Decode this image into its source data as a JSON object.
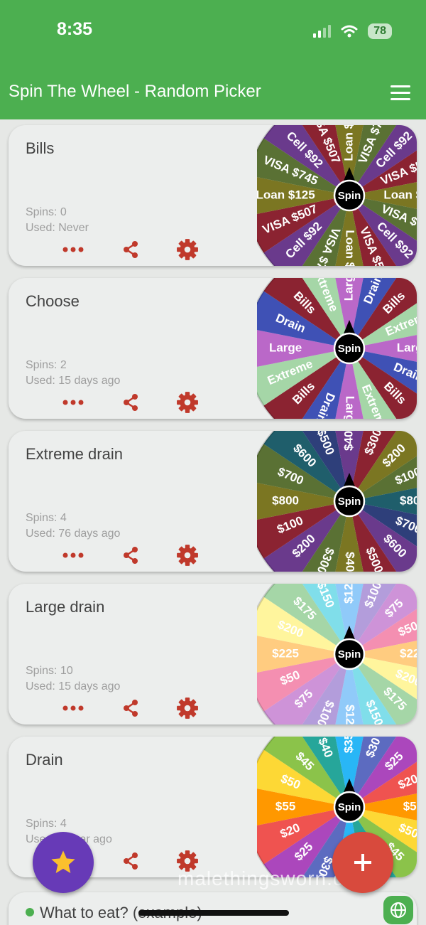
{
  "status_bar": {
    "time": "8:35",
    "battery": "78"
  },
  "header": {
    "title": "Spin The Wheel - Random Picker"
  },
  "wheels": [
    {
      "name": "Bills",
      "spins": "Spins: 0",
      "used": "Used: Never",
      "segments": [
        "Cell $92",
        "VISA $507",
        "Loan $125",
        "VISA $745",
        "Cell $92",
        "VISA $507",
        "Loan $125",
        "VISA $745",
        "Cell $92",
        "VISA $507",
        "Loan $125",
        "VISA $745",
        "Cell $92",
        "VISA $507",
        "Loan $125",
        "VISA $745"
      ],
      "colors": [
        "#6a3a8c",
        "#8b2331",
        "#7b7622",
        "#5a7134"
      ]
    },
    {
      "name": "Choose",
      "spins": "Spins: 2",
      "used": "Used: 15 days ago",
      "segments": [
        "Bills",
        "Extreme",
        "Large",
        "Drain",
        "Bills",
        "Extreme",
        "Large",
        "Drain",
        "Bills",
        "Extreme",
        "Large",
        "Drain",
        "Bills",
        "Extreme",
        "Large",
        "Drain"
      ],
      "colors": [
        "#8b2331",
        "#a5d6a7",
        "#ba68c8",
        "#3f51b5"
      ]
    },
    {
      "name": "Extreme drain",
      "spins": "Spins: 4",
      "used": "Used: 76 days ago",
      "segments": [
        "$200",
        "$100",
        "$800",
        "$700",
        "$600",
        "$500",
        "$400",
        "$300",
        "$200",
        "$100",
        "$800",
        "$700",
        "$600",
        "$500",
        "$400",
        "$300"
      ],
      "colors": [
        "#6a3a8c",
        "#8b2331",
        "#7b7622",
        "#5a7134",
        "#1f5e6b",
        "#2e3f7a"
      ]
    },
    {
      "name": "Large drain",
      "spins": "Spins: 10",
      "used": "Used: 15 days ago",
      "segments": [
        "$75",
        "$50",
        "$225",
        "$200",
        "$175",
        "$150",
        "$125",
        "$100",
        "$75",
        "$50",
        "$225",
        "$200",
        "$175",
        "$150",
        "$125",
        "$100"
      ],
      "colors": [
        "#ce93d8",
        "#f48fb1",
        "#ffcc80",
        "#fff59d",
        "#a5d6a7",
        "#80deea",
        "#90caf9",
        "#b39ddb"
      ]
    },
    {
      "name": "Drain",
      "spins": "Spins: 4",
      "used": "Used: 1 year ago",
      "segments": [
        "$25",
        "$20",
        "$55",
        "$50",
        "$45",
        "$40",
        "$35",
        "$30",
        "$25",
        "$20",
        "$55",
        "$50",
        "$45",
        "$40",
        "$35",
        "$30"
      ],
      "colors": [
        "#ab47bc",
        "#ef5350",
        "#ff9800",
        "#fdd835",
        "#8bc34a",
        "#26a69a",
        "#29b6f6",
        "#5c6bc0"
      ]
    }
  ],
  "spin_label": "Spin",
  "next_card": {
    "name": "What to eat? (example)"
  },
  "watermark": "malethingsworn.com",
  "icons": {
    "menu": "menu-icon",
    "more": "more-dots-icon",
    "share": "share-icon",
    "settings": "settings-gear-icon",
    "star": "star-icon",
    "add": "plus-icon",
    "globe": "globe-icon"
  },
  "colors": {
    "primary": "#4caf50",
    "accent_red": "#d84a3d",
    "fab_purple": "#673ab7",
    "star": "#fbc02d"
  }
}
